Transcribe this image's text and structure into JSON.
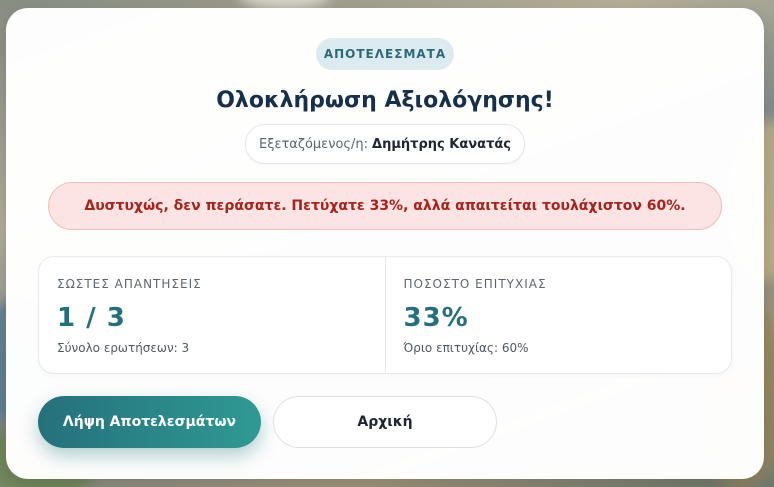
{
  "badge": "ΑΠΟΤΕΛΕΣΜΑΤΑ",
  "title": "Ολοκλήρωση Αξιολόγησης!",
  "examinee": {
    "label": "Εξεταζόμενος/η:",
    "name": "Δημήτρης Κανατάς"
  },
  "alert": "Δυστυχώς, δεν περάσατε. Πετύχατε 33%, αλλά απαιτείται τουλάχιστον 60%.",
  "stats": {
    "correct": {
      "label": "ΣΩΣΤΕΣ ΑΠΑΝΤΗΣΕΙΣ",
      "value": "1 / 3",
      "sub": "Σύνολο ερωτήσεων: 3"
    },
    "success": {
      "label": "ΠΟΣΟΣΤΟ ΕΠΙΤΥΧΙΑΣ",
      "value": "33%",
      "sub": "Όριο επιτυχίας: 60%"
    }
  },
  "buttons": {
    "download": "Λήψη Αποτελεσμάτων",
    "home": "Αρχική"
  },
  "colors": {
    "accent": "#236f7c",
    "error": "#a8231b",
    "error_bg": "#fbe4e3",
    "title": "#17304a"
  }
}
